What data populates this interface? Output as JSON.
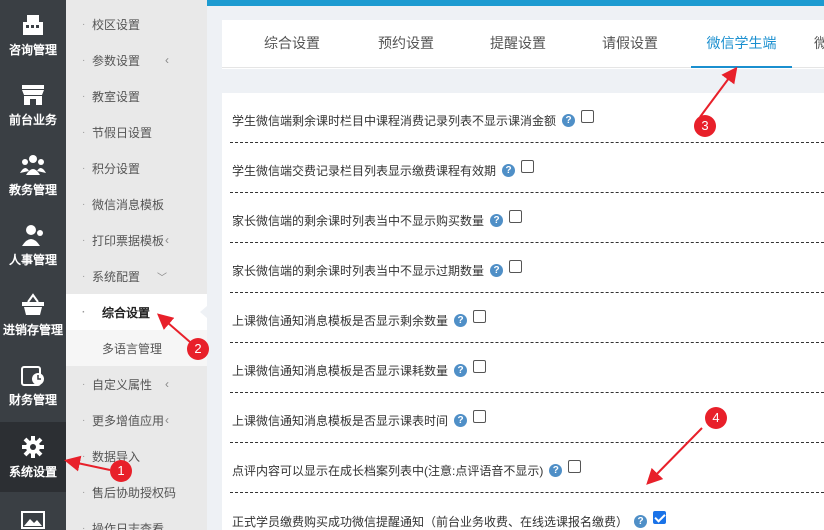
{
  "rail": [
    {
      "label": "咨询管理",
      "icon": "cash-register-icon"
    },
    {
      "label": "前台业务",
      "icon": "storefront-icon"
    },
    {
      "label": "教务管理",
      "icon": "people-group-icon"
    },
    {
      "label": "人事管理",
      "icon": "user-manage-icon"
    },
    {
      "label": "进销存管理",
      "icon": "shopping-basket-icon"
    },
    {
      "label": "财务管理",
      "icon": "finance-clock-icon"
    },
    {
      "label": "系统设置",
      "icon": "gear-icon"
    }
  ],
  "submenu": [
    {
      "label": "校区设置"
    },
    {
      "label": "参数设置"
    },
    {
      "label": "教室设置"
    },
    {
      "label": "节假日设置"
    },
    {
      "label": "积分设置"
    },
    {
      "label": "微信消息模板"
    },
    {
      "label": "打印票据模板"
    },
    {
      "label": "系统配置"
    },
    {
      "label": "综合设置"
    },
    {
      "label": "多语言管理"
    },
    {
      "label": "自定义属性"
    },
    {
      "label": "更多增值应用"
    },
    {
      "label": "数据导入"
    },
    {
      "label": "售后协助授权码"
    },
    {
      "label": "操作日志查看"
    }
  ],
  "tabs": [
    {
      "label": "综合设置"
    },
    {
      "label": "预约设置"
    },
    {
      "label": "提醒设置"
    },
    {
      "label": "请假设置"
    },
    {
      "label": "微信学生端"
    },
    {
      "label": "微"
    }
  ],
  "settings": [
    {
      "label": "学生微信端剩余课时栏目中课程消费记录列表不显示课消金额",
      "checked": false
    },
    {
      "label": "学生微信端交费记录栏目列表显示缴费课程有效期",
      "checked": false
    },
    {
      "label": "家长微信端的剩余课时列表当中不显示购买数量",
      "checked": false
    },
    {
      "label": "家长微信端的剩余课时列表当中不显示过期数量",
      "checked": false
    },
    {
      "label": "上课微信通知消息模板是否显示剩余数量",
      "checked": false
    },
    {
      "label": "上课微信通知消息模板是否显示课耗数量",
      "checked": false
    },
    {
      "label": "上课微信通知消息模板是否显示课表时间",
      "checked": false
    },
    {
      "label": "点评内容可以显示在成长档案列表中(注意:点评语音不显示)",
      "checked": false
    },
    {
      "label": "正式学员缴费购买成功微信提醒通知（前台业务收费、在线选课报名缴费）",
      "checked": true
    }
  ],
  "help_glyph": "?",
  "annotations": [
    "1",
    "2",
    "3",
    "4"
  ],
  "colors": {
    "accent": "#1a8fcf",
    "annotation": "#e8202a",
    "rail": "#3a3f44"
  }
}
